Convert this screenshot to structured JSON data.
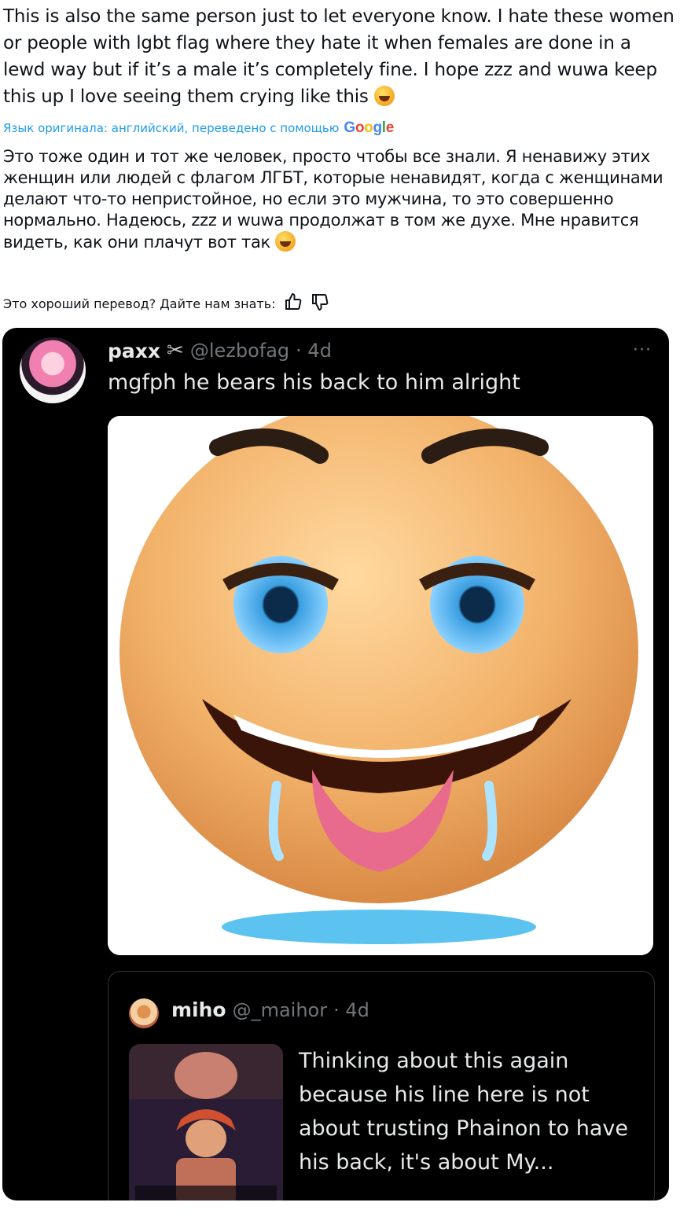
{
  "original_text": "This is also the same person just to let everyone know. I hate these women or people with lgbt flag where they hate it when females are done in a lewd way but if it’s a male it’s completely fine. I hope zzz and wuwa keep this up I love seeing them crying like this",
  "translation_label": "Язык оригинала: английский, переведено с помощью",
  "translation_provider": "Google",
  "translated_text": "Это тоже один и тот же человек, просто чтобы все знали. Я ненавижу этих женщин или людей с флагом ЛГБТ, которые ненавидят, когда с женщинами делают что-то непристойное, но если это мужчина, то это совершенно нормально. Надеюсь, zzz и wuwa продолжат в том же духе. Мне нравится видеть, как они плачут вот так",
  "feedback_prompt": "Это хороший перевод? Дайте нам знать:",
  "embedded_post": {
    "display_name": "paxx",
    "handle": "@lezbofag",
    "time": "· 4d",
    "text": "mgfph he bears his back to him alright",
    "more_label": "···",
    "quoted": {
      "display_name": "miho",
      "handle": "@_maihor",
      "time": "· 4d",
      "text": "Thinking about this again because his line here is not about trusting Phainon to have his back, it's about My..."
    }
  },
  "icons": {
    "emoji": "rolling-on-floor-laughing-icon",
    "thumbs_up": "thumbs-up-icon",
    "thumbs_down": "thumbs-down-icon",
    "scissors": "scissors-icon"
  }
}
